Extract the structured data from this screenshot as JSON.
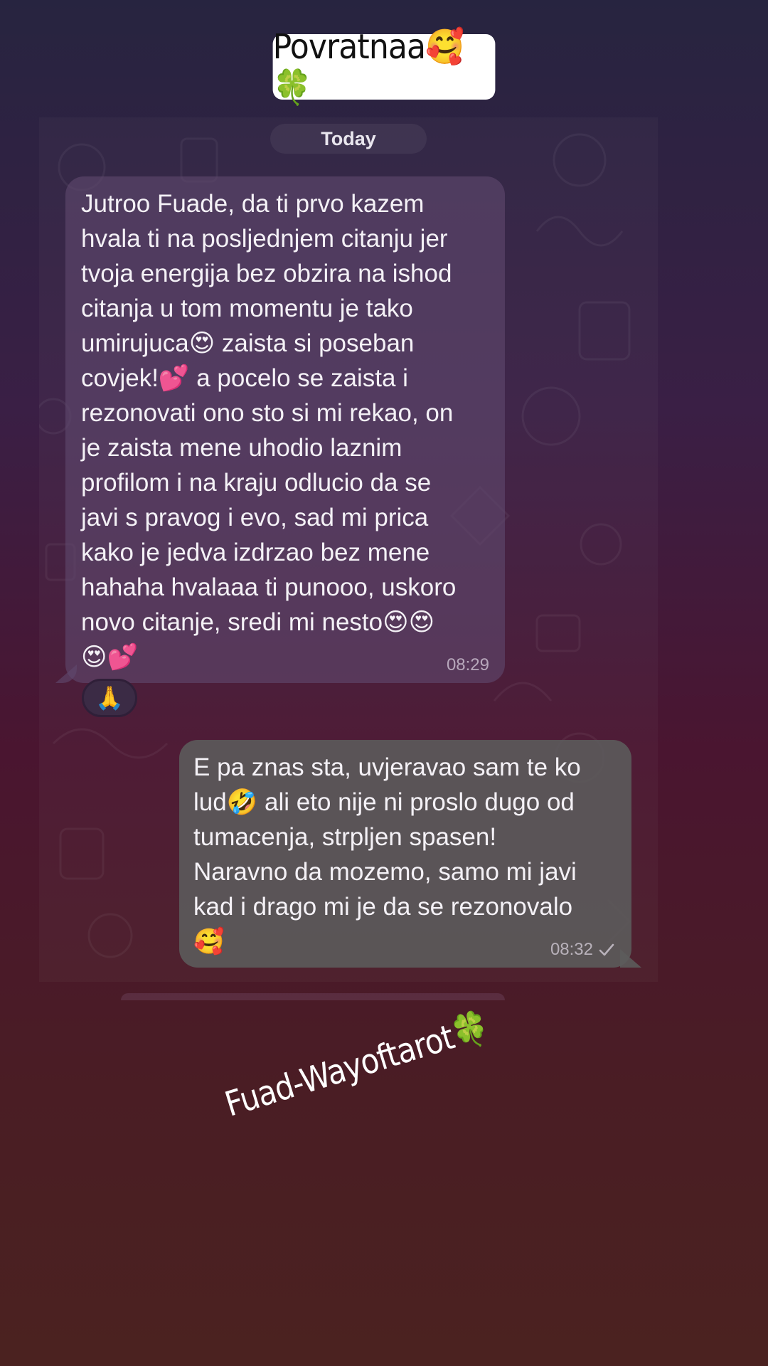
{
  "sticker": {
    "title": "Povratnaa🥰🍀"
  },
  "chat": {
    "date_label": "Today",
    "messages": [
      {
        "direction": "incoming",
        "text": "Jutroo Fuade, da ti prvo kazem\nhvala ti na posljednjem citanju jer\ntvoja energija bez obzira na ishod\ncitanja u tom momentu je tako\numirujuca😍 zaista si poseban\ncovjek!💕 a pocelo se zaista i\nrezonovati ono sto si mi rekao, on\nje zaista mene uhodio laznim\nprofilom i na kraju odlucio da se\njavi s pravog i evo, sad mi prica\nkako je jedva izdrzao bez mene\nhahaha hvalaaa ti punooo, uskoro\nnovo citanje, sredi mi nesto😍😍\n😍💕",
        "time": "08:29",
        "reaction": "🙏"
      },
      {
        "direction": "outgoing",
        "text": "E pa znas sta, uvjeravao sam te ko\nlud🤣 ali eto nije ni proslo dugo od\ntumacenja, strpljen spasen!\nNaravno da mozemo, samo mi javi\nkad i drago mi je da se rezonovalo\n🥰",
        "time": "08:32",
        "status_icon": "single-check-icon"
      }
    ]
  },
  "watermark": {
    "text": "Fuad-Wayoftarot🍀"
  },
  "colors": {
    "incoming_bubble": "#5f486e",
    "outgoing_bubble": "#5c5c5c",
    "background_top": "#272440",
    "background_bottom": "#4b2220"
  }
}
